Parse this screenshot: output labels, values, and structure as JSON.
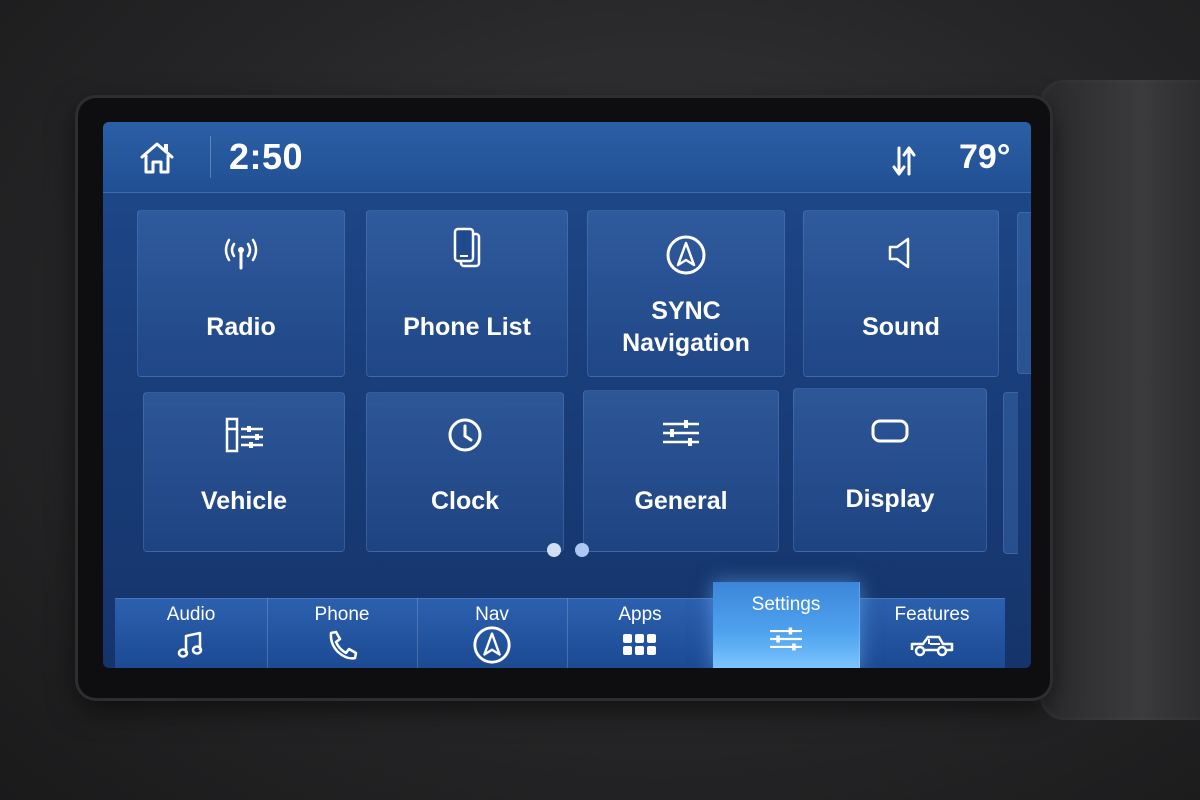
{
  "status_bar": {
    "time": "2:50",
    "temperature": "79°",
    "home_icon": "home-icon",
    "signal_icon": "data-transfer-icon"
  },
  "tiles": [
    {
      "label": "Radio",
      "icon": "radio-antenna-icon"
    },
    {
      "label": "Phone List",
      "icon": "phones-icon"
    },
    {
      "label_line1": "SYNC",
      "label_line2": "Navigation",
      "icon": "navigation-arrow-icon"
    },
    {
      "label": "Sound",
      "icon": "speaker-icon"
    },
    {
      "label": "Vehicle",
      "icon": "vehicle-settings-icon"
    },
    {
      "label": "Clock",
      "icon": "clock-icon"
    },
    {
      "label": "General",
      "icon": "sliders-icon"
    },
    {
      "label": "Display",
      "icon": "display-icon"
    }
  ],
  "pager": {
    "pages": 2,
    "current": 1
  },
  "nav": [
    {
      "label": "Audio",
      "icon": "music-note-icon"
    },
    {
      "label": "Phone",
      "icon": "phone-handset-icon"
    },
    {
      "label": "Nav",
      "icon": "navigation-arrow-icon"
    },
    {
      "label": "Apps",
      "icon": "apps-grid-icon"
    },
    {
      "label": "Settings",
      "icon": "sliders-icon",
      "active": true
    },
    {
      "label": "Features",
      "icon": "truck-icon"
    }
  ],
  "colors": {
    "screen_blue": "#1f4a8d",
    "active_tab": "#4fa3ef"
  }
}
